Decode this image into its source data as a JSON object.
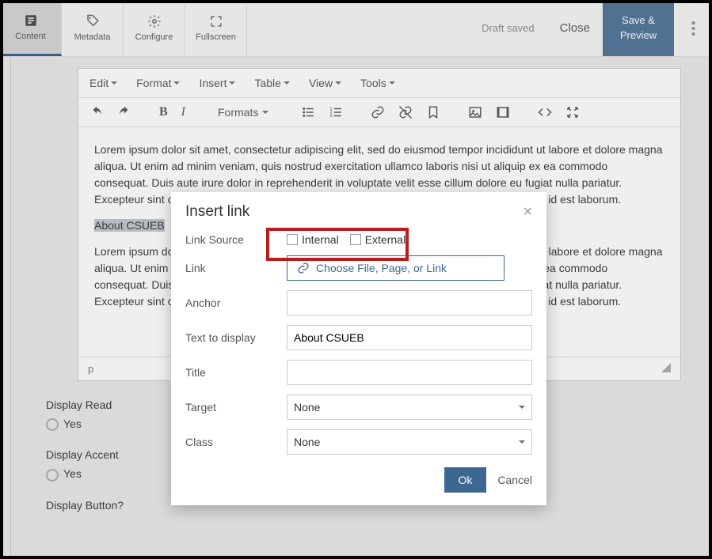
{
  "topbar": {
    "tabs": {
      "content": "Content",
      "metadata": "Metadata",
      "configure": "Configure",
      "fullscreen": "Fullscreen"
    },
    "draft_saved": "Draft saved",
    "close": "Close",
    "save_preview": "Save & Preview"
  },
  "editor": {
    "menubar": {
      "edit": "Edit",
      "format": "Format",
      "insert": "Insert",
      "table": "Table",
      "view": "View",
      "tools": "Tools"
    },
    "formats_label": "Formats",
    "body": {
      "p1": "Lorem ipsum dolor sit amet, consectetur adipiscing elit, sed do eiusmod tempor incididunt ut labore et dolore magna aliqua. Ut enim ad minim veniam, quis nostrud exercitation ullamco laboris nisi ut aliquip ex ea commodo consequat. Duis aute irure dolor in reprehenderit in voluptate velit esse cillum dolore eu fugiat nulla pariatur. Excepteur sint occaecat cupidatat non proident, sunt in culpa qui officia deserunt mollit anim id est laborum.",
      "highlighted": "About CSUEB",
      "p2": "Lorem ipsum dolor sit amet, consectetur adipiscing elit, sed do eiusmod tempor incididunt ut labore et dolore magna aliqua. Ut enim ad minim veniam, quis nostrud exercitation ullamco laboris nisi ut aliquip ex ea commodo consequat. Duis aute irure dolor in reprehenderit in voluptate velit esse cillum dolore eu fugiat nulla pariatur. Excepteur sint occaecat cupidatat non proident, sunt in culpa qui officia deserunt mollit anim id est laborum."
    },
    "path": "p"
  },
  "form": {
    "display_read_label": "Display Read",
    "display_accent_label": "Display Accent",
    "display_button_label": "Display Button?",
    "yes": "Yes"
  },
  "modal": {
    "title": "Insert link",
    "labels": {
      "link_source": "Link Source",
      "link": "Link",
      "anchor": "Anchor",
      "text_to_display": "Text to display",
      "title": "Title",
      "target": "Target",
      "class": "Class"
    },
    "source_internal": "Internal",
    "source_external": "External",
    "chooser": "Choose File, Page, or Link",
    "text_value": "About CSUEB",
    "target_value": "None",
    "class_value": "None",
    "ok": "Ok",
    "cancel": "Cancel"
  }
}
